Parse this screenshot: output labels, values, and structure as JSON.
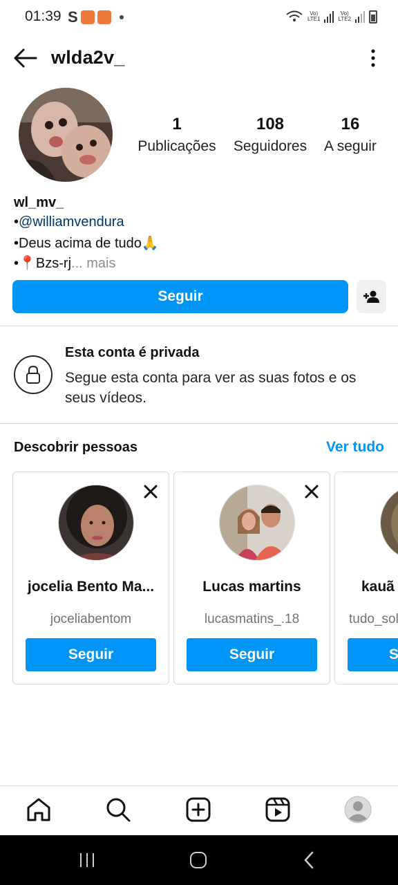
{
  "status_bar": {
    "time": "01:39",
    "left_glyph": "S",
    "sim1": "LTE1",
    "sim2": "LTE2",
    "volte": "Vo)"
  },
  "header": {
    "title": "wlda2v_",
    "back_icon": "arrow-left-icon",
    "menu_icon": "more-vertical-icon"
  },
  "profile": {
    "posts_count": "1",
    "posts_label": "Publicações",
    "followers_count": "108",
    "followers_label": "Seguidores",
    "following_count": "16",
    "following_label": "A seguir",
    "name": "wl_mv_",
    "bio_bullet": "•",
    "bio_link": "@williamvendura",
    "bio_line2": "•Deus acima de tudo🙏",
    "bio_line3_prefix": "•📍Bzs-rj",
    "bio_more": "... mais",
    "follow_label": "Seguir"
  },
  "private": {
    "title": "Esta conta é privada",
    "description": "Segue esta conta para ver as suas fotos e os seus vídeos."
  },
  "discover": {
    "title": "Descobrir pessoas",
    "see_all": "Ver tudo",
    "cards": [
      {
        "name": "jocelia Bento Ma...",
        "handle": "joceliabentom",
        "button": "Seguir"
      },
      {
        "name": "Lucas martins",
        "handle": "lucasmatins_.18",
        "button": "Seguir"
      },
      {
        "name": "kauã",
        "handle": "tudo_sol",
        "button": "S"
      }
    ]
  },
  "colors": {
    "accent": "#0095f6",
    "link": "#00376b",
    "muted": "#737373",
    "border": "#dbdbdb"
  }
}
